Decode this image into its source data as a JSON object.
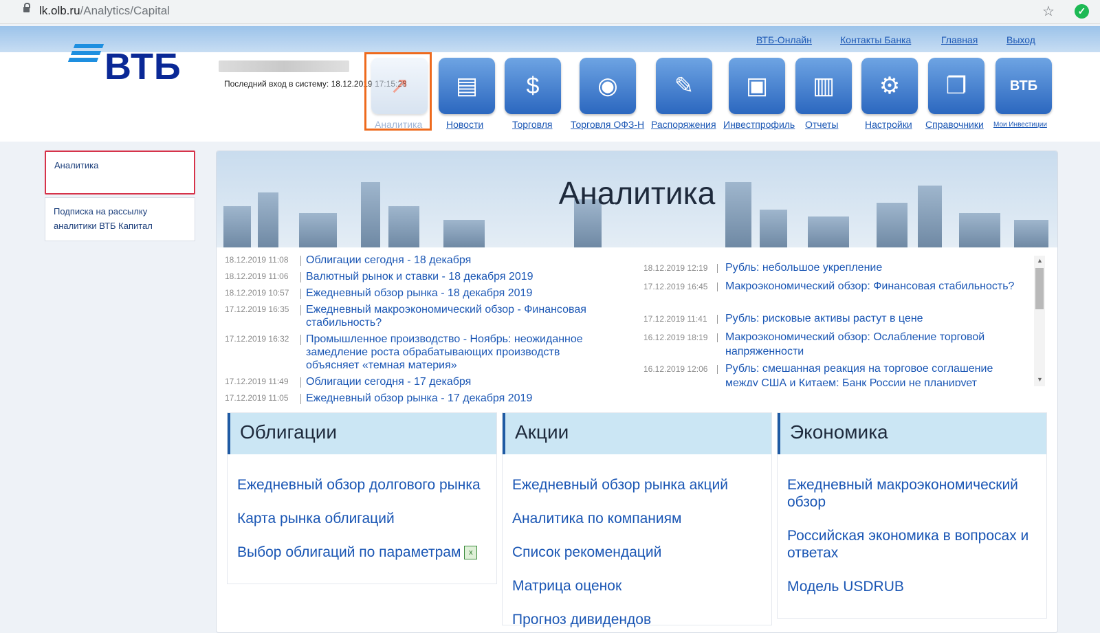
{
  "browser": {
    "url_domain": "lk.olb.ru",
    "url_path": "/Analytics/Capital",
    "star_icon": "star-icon",
    "extension_icon": "check-circle-icon"
  },
  "top_links": [
    "ВТБ-Онлайн",
    "Контакты Банка",
    "Главная",
    "Выход"
  ],
  "logo": {
    "text": "ВТБ"
  },
  "last_login": "Последний вход в систему: 18.12.2019 17:15:28",
  "nav": [
    {
      "label": "Аналитика",
      "icon": "chart-icon",
      "active": true
    },
    {
      "label": "Новости",
      "icon": "news-icon"
    },
    {
      "label": "Торговля",
      "icon": "briefcase-money-icon"
    },
    {
      "label": "Торговля ОФЗ-Н",
      "icon": "coins-globe-icon"
    },
    {
      "label": "Распоряжения",
      "icon": "folders-pen-icon"
    },
    {
      "label": "Инвестпрофиль",
      "icon": "portfolio-icon"
    },
    {
      "label": "Отчеты",
      "icon": "report-chart-icon"
    },
    {
      "label": "Настройки",
      "icon": "settings-person-icon"
    },
    {
      "label": "Справочники",
      "icon": "books-icon"
    },
    {
      "label": "Мои Инвестиции",
      "icon": "vtb-invest-icon"
    }
  ],
  "sidebar": [
    {
      "label": "Аналитика",
      "selected": true
    },
    {
      "label": "Подписка на рассылку аналитики ВТБ Капитал"
    }
  ],
  "banner_title": "Аналитика",
  "news_left": [
    {
      "date": "18.12.2019 11:08",
      "title": "Облигации сегодня - 18 декабря"
    },
    {
      "date": "18.12.2019 11:06",
      "title": "Валютный рынок и ставки - 18 декабря 2019"
    },
    {
      "date": "18.12.2019 10:57",
      "title": "Ежедневный обзор рынка - 18 декабря 2019"
    },
    {
      "date": "17.12.2019 16:35",
      "title": "Ежедневный макроэкономический обзор - Финансовая стабильность?"
    },
    {
      "date": "17.12.2019 16:32",
      "title": "Промышленное производство - Ноябрь: неожиданное замедление роста обрабатывающих производств объясняет «темная материя»"
    },
    {
      "date": "17.12.2019 11:49",
      "title": "Облигации сегодня - 17 декабря"
    },
    {
      "date": "17.12.2019 11:05",
      "title": "Ежедневный обзор рынка - 17 декабря 2019"
    }
  ],
  "news_right": [
    {
      "date": "18.12.2019 12:19",
      "title": "Рубль: небольшое укрепление"
    },
    {
      "date": "17.12.2019 16:45",
      "title": "Макроэкономический обзор: Финансовая стабильность?"
    },
    {
      "date": "17.12.2019 11:41",
      "title": "Рубль: рисковые активы растут в цене"
    },
    {
      "date": "16.12.2019 18:19",
      "title": "Макроэкономический обзор: Ослабление торговой напряженности"
    },
    {
      "date": "16.12.2019 12:06",
      "title": "Рубль: смешанная реакция на торговое соглашение между США и Китаем; Банк России не планирует"
    }
  ],
  "categories": [
    {
      "title": "Облигации",
      "links": [
        "Ежедневный обзор долгового рынка",
        "Карта рынка облигаций",
        "Выбор облигаций по параметрам"
      ]
    },
    {
      "title": "Акции",
      "links": [
        "Ежедневный обзор рынка акций",
        "Аналитика по компаниям",
        "Список рекомендаций",
        "Матрица оценок",
        "Прогноз дивидендов"
      ]
    },
    {
      "title": "Экономика",
      "links": [
        "Ежедневный макроэкономический обзор",
        "Российская экономика в вопросах и ответах",
        "Модель USDRUB"
      ]
    }
  ],
  "colors": {
    "accent": "#1a56b4",
    "brand": "#0a2896",
    "highlight": "#ee6a1d",
    "selected_border": "#d6334a"
  }
}
